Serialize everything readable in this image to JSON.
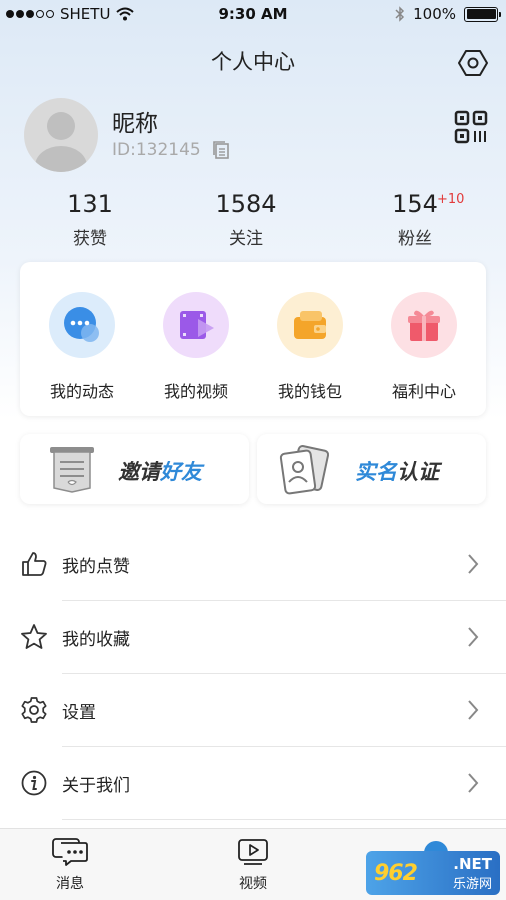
{
  "status_bar": {
    "carrier": "SHETU",
    "time": "9:30 AM",
    "battery": "100%"
  },
  "header": {
    "title": "个人中心"
  },
  "profile": {
    "nickname": "昵称",
    "user_id": "ID:132145"
  },
  "stats": [
    {
      "value": "131",
      "label": "获赞"
    },
    {
      "value": "1584",
      "label": "关注"
    },
    {
      "value": "154",
      "label": "粉丝",
      "badge": "+10"
    }
  ],
  "quick_actions": [
    {
      "label": "我的动态",
      "icon": "chat-bubble-icon",
      "color": "#3a8ee6"
    },
    {
      "label": "我的视频",
      "icon": "video-play-icon",
      "color": "#9b59e8"
    },
    {
      "label": "我的钱包",
      "icon": "wallet-icon",
      "color": "#f4a52a"
    },
    {
      "label": "福利中心",
      "icon": "gift-icon",
      "color": "#ef5a6b"
    }
  ],
  "banners": {
    "invite": {
      "part1": "邀请",
      "part2": "好友"
    },
    "verify": {
      "part1": "实名",
      "part2": "认证"
    }
  },
  "menu": [
    {
      "label": "我的点赞",
      "icon": "thumbs-up-icon"
    },
    {
      "label": "我的收藏",
      "icon": "star-icon"
    },
    {
      "label": "设置",
      "icon": "gear-icon"
    },
    {
      "label": "关于我们",
      "icon": "info-icon"
    }
  ],
  "tabbar": {
    "messages": "消息",
    "videos": "视频"
  },
  "watermark": {
    "main": "962",
    "net": ".NET",
    "sub": "乐游网"
  },
  "colors": {
    "accent": "#2f89d8",
    "badge_red": "#e23b3b"
  }
}
